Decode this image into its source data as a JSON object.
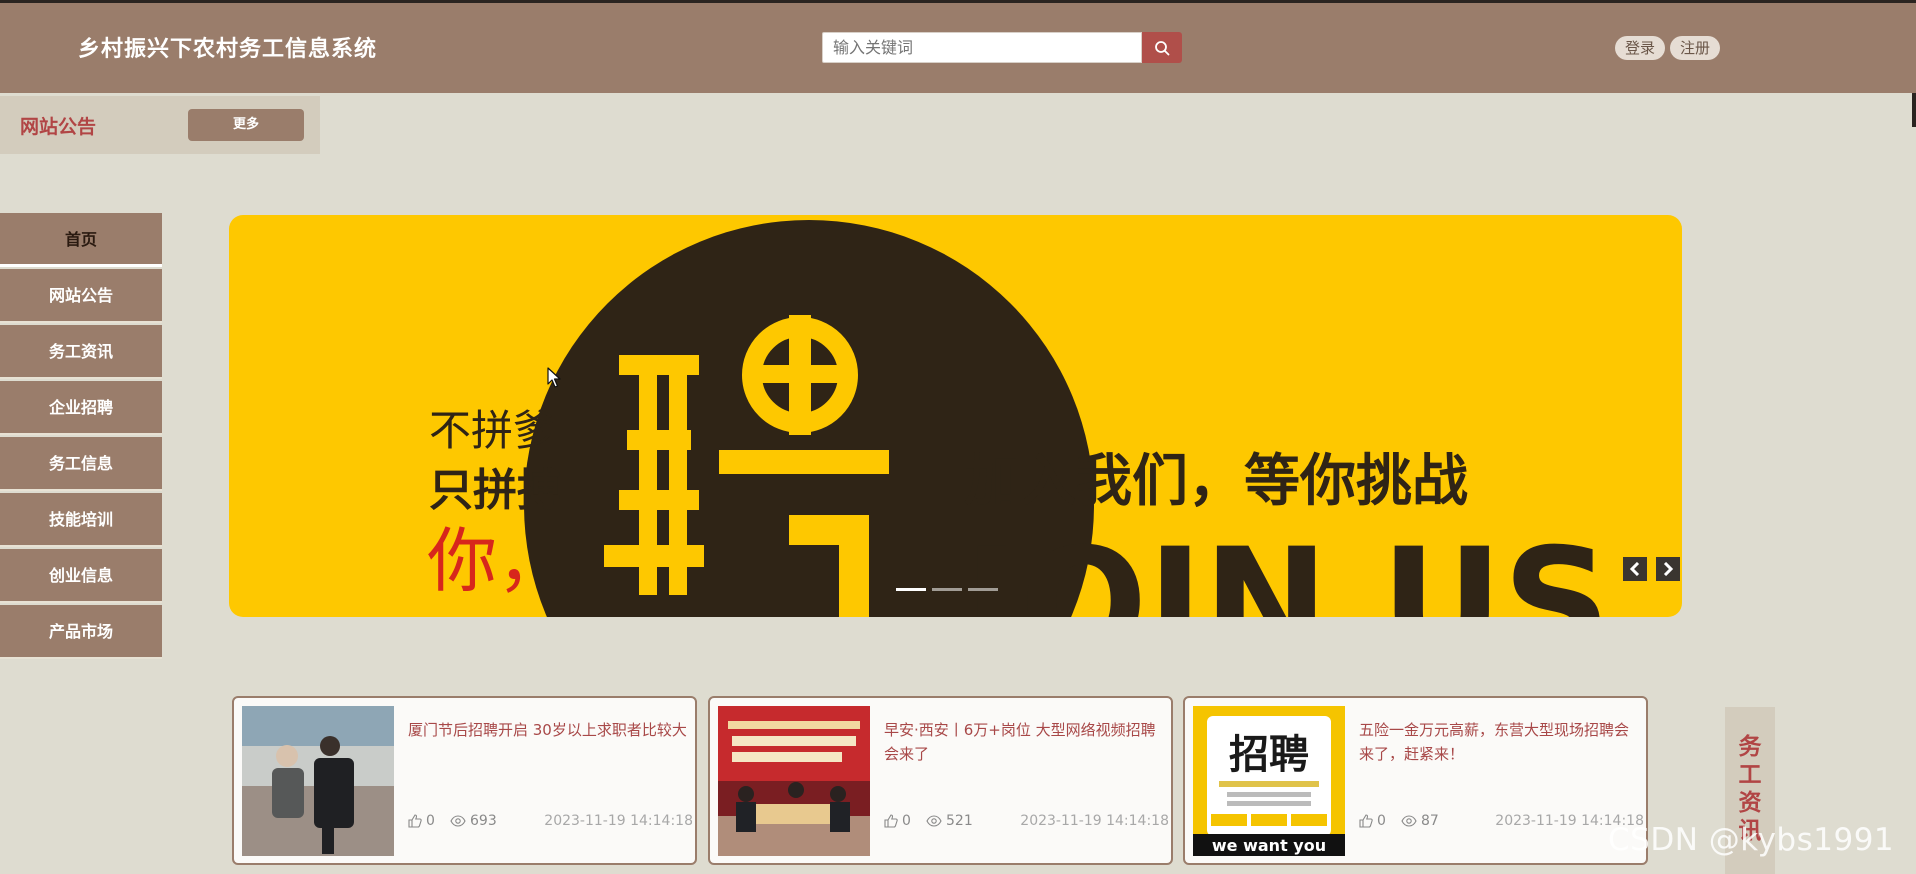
{
  "header": {
    "site_title": "乡村振兴下农村务工信息系统",
    "search_placeholder": "输入关键词",
    "login_label": "登录",
    "register_label": "注册"
  },
  "notice": {
    "title": "网站公告",
    "more_label": "更多"
  },
  "nav": {
    "items": [
      {
        "label": "首页",
        "active": true
      },
      {
        "label": "网站公告"
      },
      {
        "label": "务工资讯"
      },
      {
        "label": "企业招聘"
      },
      {
        "label": "务工信息"
      },
      {
        "label": "技能培训"
      },
      {
        "label": "创业信息"
      },
      {
        "label": "产品市场"
      }
    ]
  },
  "banner": {
    "line1": "不拼爹",
    "line2": "只拼搏",
    "line3": "你，",
    "big_char": "聘",
    "slogan": "加入我们，等你挑战",
    "join_text": "JOIN US",
    "slide_count": 3,
    "active_slide": 1
  },
  "cards": [
    {
      "title": "厦门节后招聘开启 30岁以上求职者比较大",
      "likes": "0",
      "views": "693",
      "date": "2023-11-19 14:14:18"
    },
    {
      "title": "早安·西安丨6万+岗位 大型网络视频招聘会来了",
      "likes": "0",
      "views": "521",
      "date": "2023-11-19 14:14:18"
    },
    {
      "title": "五险一金万元高薪，东营大型现场招聘会来了，赶紧来！",
      "likes": "0",
      "views": "87",
      "date": "2023-11-19 14:14:18",
      "thumb_text_main": "招聘",
      "thumb_text_sub": "we want you"
    }
  ],
  "side_tab": {
    "label": "务工资讯"
  },
  "watermark": "CSDN @kybs1991",
  "colors": {
    "header_bg": "#9a7d6b",
    "page_bg": "#dedcd0",
    "accent_red": "#b14545",
    "banner_yellow": "#fec800"
  }
}
